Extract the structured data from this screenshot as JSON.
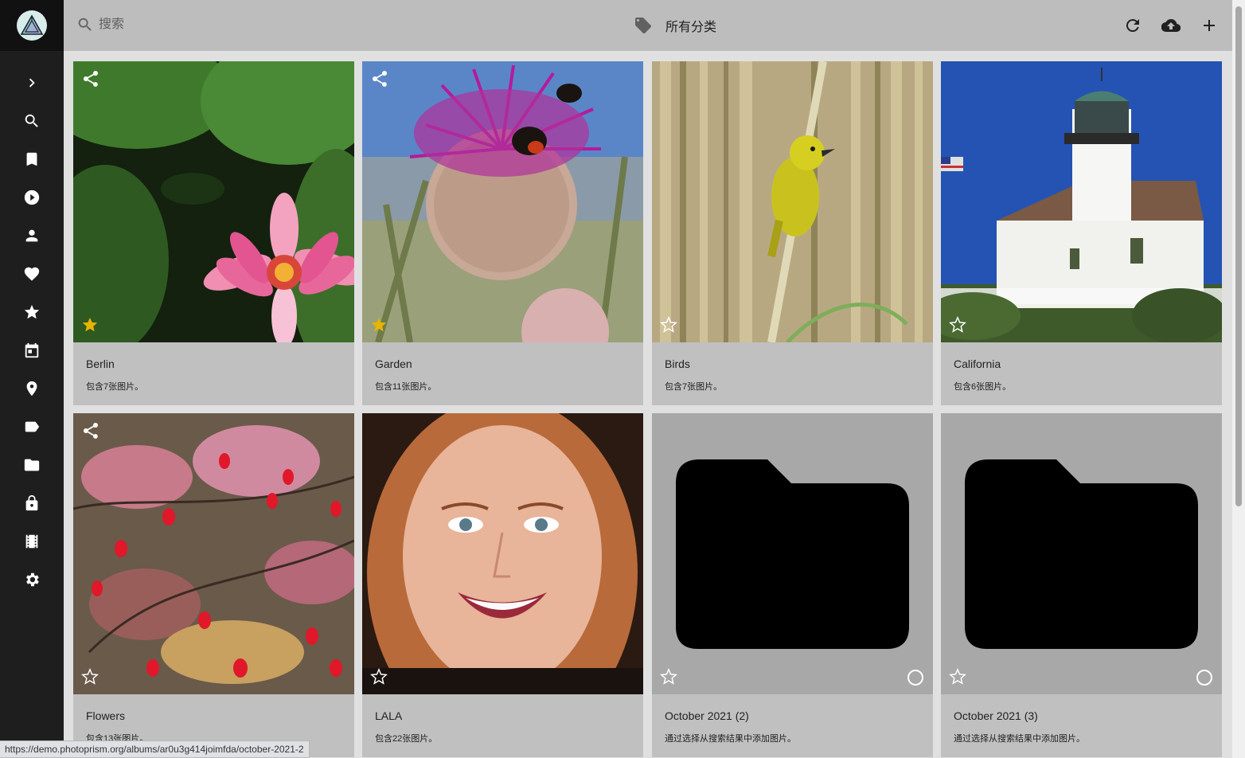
{
  "toolbar": {
    "search_placeholder": "搜索",
    "category_label": "所有分类"
  },
  "sidebar": {
    "items": [
      {
        "icon": "chevron-right-icon"
      },
      {
        "icon": "search-icon"
      },
      {
        "icon": "bookmark-icon"
      },
      {
        "icon": "play-circle-icon"
      },
      {
        "icon": "person-icon"
      },
      {
        "icon": "heart-icon"
      },
      {
        "icon": "star-icon"
      },
      {
        "icon": "calendar-icon"
      },
      {
        "icon": "place-icon"
      },
      {
        "icon": "label-icon"
      },
      {
        "icon": "folder-icon"
      },
      {
        "icon": "lock-icon"
      },
      {
        "icon": "film-icon"
      },
      {
        "icon": "settings-icon"
      }
    ]
  },
  "albums": [
    {
      "title": "Berlin",
      "subtitle": "包含7张图片。",
      "shared": true,
      "favorite": true,
      "image": "pink-water-lily"
    },
    {
      "title": "Garden",
      "subtitle": "包含11张图片。",
      "shared": true,
      "favorite": true,
      "image": "thistle-with-bees"
    },
    {
      "title": "Birds",
      "subtitle": "包含7张图片。",
      "shared": false,
      "favorite": false,
      "image": "yellow-bird-on-reed"
    },
    {
      "title": "California",
      "subtitle": "包含6张图片。",
      "shared": false,
      "favorite": false,
      "image": "white-lighthouse"
    },
    {
      "title": "Flowers",
      "subtitle": "包含13张图片。",
      "shared": true,
      "favorite": false,
      "image": "red-berries"
    },
    {
      "title": "LALA",
      "subtitle": "包含22张图片。",
      "shared": false,
      "favorite": false,
      "image": "smiling-woman-portrait"
    },
    {
      "title": "October 2021 (2)",
      "subtitle": "通过选择从搜索结果中添加图片。",
      "shared": false,
      "favorite": false,
      "image": "folder-placeholder"
    },
    {
      "title": "October 2021 (3)",
      "subtitle": "通过选择从搜索结果中添加图片。",
      "shared": false,
      "favorite": false,
      "image": "folder-placeholder"
    }
  ],
  "status_url": "https://demo.photoprism.org/albums/ar0u3g414joimfda/october-2021-2",
  "colors": {
    "sidebar_bg": "#1e1e1e",
    "toolbar_bg": "#bdbdbd",
    "card_bg": "#c0c0c0",
    "favorite_star": "#e8b400",
    "folder_placeholder_bg": "#a8a8a8"
  }
}
